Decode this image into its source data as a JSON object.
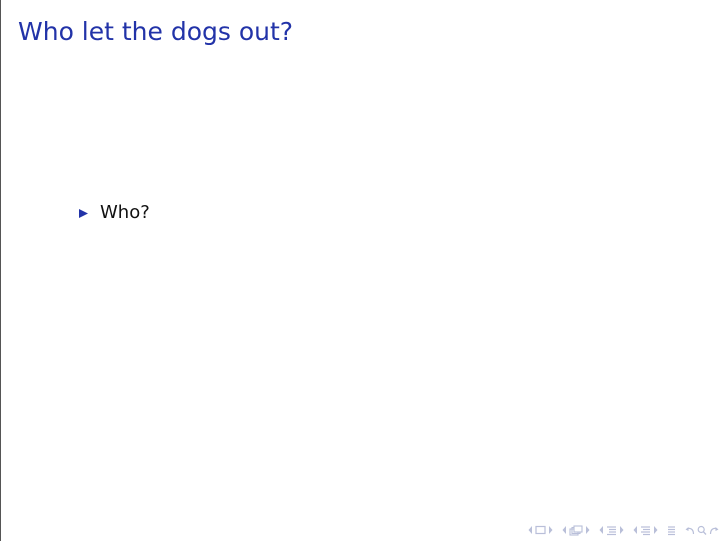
{
  "slide": {
    "title": "Who let the dogs out?",
    "items": [
      {
        "text": "Who?"
      }
    ]
  },
  "colors": {
    "title": "#2233a8",
    "bullet": "#2233a8",
    "text": "#111111",
    "nav": "#b9bfd9"
  },
  "navigation": {
    "icons": [
      "slide-prev-arrow-icon",
      "slide-icon",
      "slide-next-arrow-icon",
      "frame-prev-arrow-icon",
      "frame-icon",
      "frame-next-arrow-icon",
      "subsection-prev-arrow-icon",
      "subsection-icon",
      "subsection-next-arrow-icon",
      "section-prev-arrow-icon",
      "section-icon",
      "section-next-arrow-icon",
      "document-icon",
      "back-icon",
      "search-icon",
      "forward-icon"
    ]
  }
}
